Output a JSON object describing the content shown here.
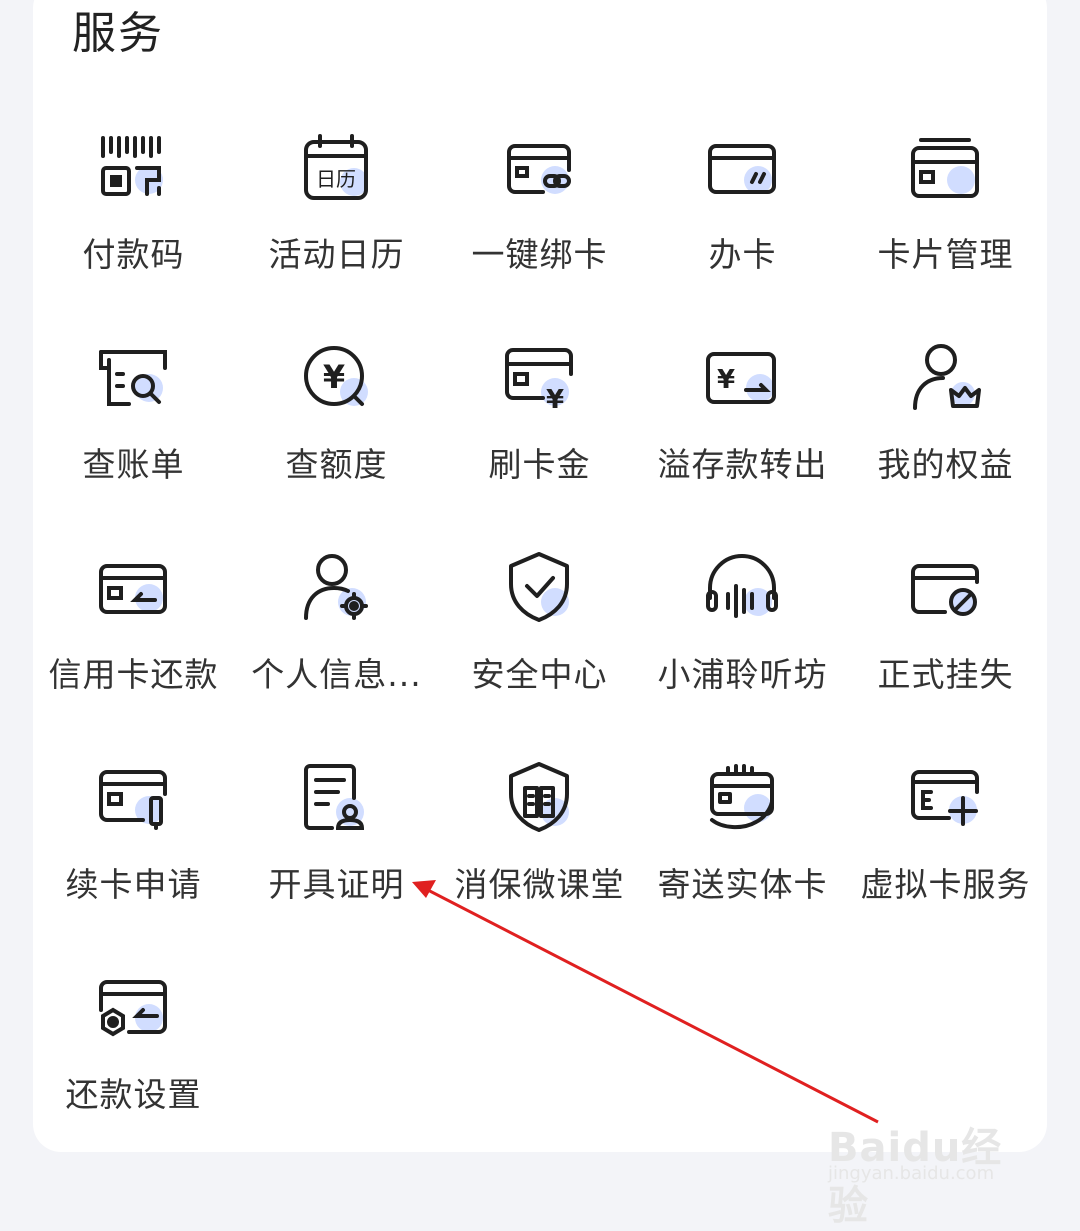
{
  "section_title": "服务",
  "rows": [
    [
      {
        "label": "付款码",
        "icon": "payment-code-icon"
      },
      {
        "label": "活动日历",
        "icon": "calendar-icon",
        "icon_text": "日历"
      },
      {
        "label": "一键绑卡",
        "icon": "bind-card-icon"
      },
      {
        "label": "办卡",
        "icon": "apply-card-icon"
      },
      {
        "label": "卡片管理",
        "icon": "card-manage-icon"
      }
    ],
    [
      {
        "label": "查账单",
        "icon": "bill-search-icon"
      },
      {
        "label": "查额度",
        "icon": "limit-search-icon",
        "icon_text": "¥"
      },
      {
        "label": "刷卡金",
        "icon": "card-cash-icon",
        "icon_text": "¥"
      },
      {
        "label": "溢存款转出",
        "icon": "transfer-out-icon",
        "icon_text": "¥"
      },
      {
        "label": "我的权益",
        "icon": "benefits-icon"
      }
    ],
    [
      {
        "label": "信用卡还款",
        "icon": "repayment-icon"
      },
      {
        "label": "个人信息...",
        "icon": "profile-settings-icon"
      },
      {
        "label": "安全中心",
        "icon": "security-shield-icon"
      },
      {
        "label": "小浦聆听坊",
        "icon": "headphones-icon"
      },
      {
        "label": "正式挂失",
        "icon": "report-loss-icon"
      }
    ],
    [
      {
        "label": "续卡申请",
        "icon": "renew-card-icon"
      },
      {
        "label": "开具证明",
        "icon": "certificate-icon"
      },
      {
        "label": "消保微课堂",
        "icon": "consumer-class-icon"
      },
      {
        "label": "寄送实体卡",
        "icon": "deliver-card-icon"
      },
      {
        "label": "虚拟卡服务",
        "icon": "virtual-card-icon"
      }
    ],
    [
      {
        "label": "还款设置",
        "icon": "repay-settings-icon"
      }
    ]
  ],
  "watermark": {
    "logo": "Baidu经验",
    "url": "jingyan.baidu.com"
  },
  "colors": {
    "icon_stroke": "#1f1f1f",
    "icon_accent": "#c9d7ff",
    "arrow": "#e02020"
  }
}
